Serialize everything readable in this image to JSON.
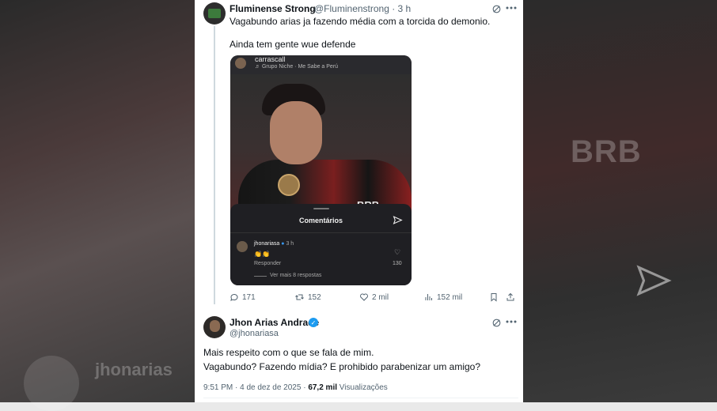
{
  "tweet1": {
    "name": "Fluminense Strong",
    "handle": "@Fluminenstrong · 3 h",
    "text_line1": "Vagabundo arias ja fazendo média com a torcida do demonio.",
    "text_line2": "Ainda tem gente wue defende",
    "embed": {
      "username": "carrascall",
      "music": "♬ Grupo Niche · Me Sabe a Perú",
      "sheet_title": "Comentários",
      "comment_user": "jhonariasa",
      "comment_time": "3 h",
      "comment_text": "👏👏",
      "reply_label": "Responder",
      "like_count": "130",
      "more_replies": "Ver mais 8 respostas",
      "photo_text": "BRB"
    },
    "actions": {
      "replies": "171",
      "retweets": "152",
      "likes": "2 mil",
      "views": "152 mil"
    }
  },
  "tweet2": {
    "name": "Jhon Arias Andrade",
    "handle": "@jhonariasa",
    "text_line1": "Mais respeito com o que se fala de mim.",
    "text_line2": "Vagabundo? Fazendo mídia? E prohibido parabenizar um amigo?",
    "timestamp": "9:51 PM · 4 de dez de 2025 · ",
    "views_count": "67,2 mil",
    "views_label": " Visualizações"
  },
  "background": {
    "left_text": "jhonarias",
    "right_text": "BRB"
  },
  "icons": [
    "grok-icon",
    "more-icon",
    "reply-icon",
    "retweet-icon",
    "like-icon",
    "views-icon",
    "bookmark-icon",
    "share-icon",
    "send-icon",
    "verified-icon",
    "heart-icon",
    "music-icon"
  ]
}
